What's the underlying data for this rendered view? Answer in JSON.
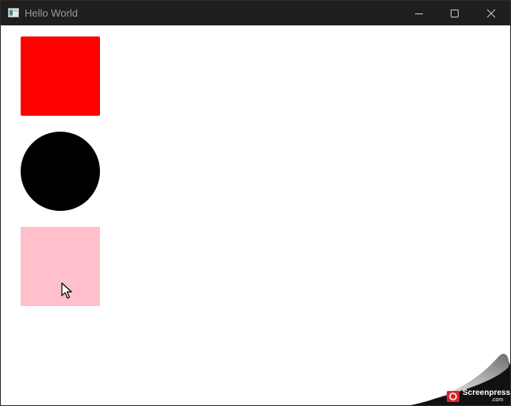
{
  "window": {
    "title": "Hello World",
    "app_icon": "window-app-icon",
    "controls": {
      "minimize_icon": "minimize-icon",
      "maximize_icon": "maximize-icon",
      "close_icon": "close-icon"
    }
  },
  "canvas": {
    "shapes": [
      {
        "kind": "square",
        "color": "#ff0000"
      },
      {
        "kind": "circle",
        "color": "#000000"
      },
      {
        "kind": "square",
        "color": "#ffc0cb"
      }
    ],
    "pointer_icon": "mouse-pointer-icon"
  },
  "watermark": {
    "brand": "Screenpresso",
    "domain": ".com",
    "logo_color": "#d9242b"
  },
  "colors": {
    "titlebar_bg": "#1f1f1f",
    "title_text": "#9a9a9a",
    "content_bg": "#ffffff"
  }
}
